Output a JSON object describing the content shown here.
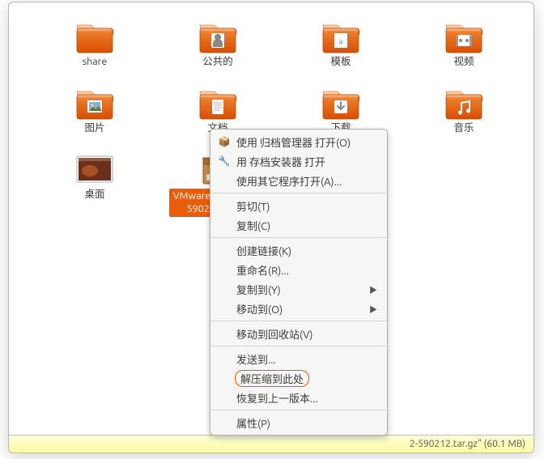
{
  "icons": [
    {
      "label": "share",
      "type": "folder-plain"
    },
    {
      "label": "公共的",
      "type": "folder-person"
    },
    {
      "label": "模板",
      "type": "folder-template"
    },
    {
      "label": "视频",
      "type": "folder-video"
    },
    {
      "label": "图片",
      "type": "folder-pictures"
    },
    {
      "label": "文档",
      "type": "folder-docs"
    },
    {
      "label": "下载",
      "type": "folder-download"
    },
    {
      "label": "音乐",
      "type": "folder-music"
    },
    {
      "label": "桌面",
      "type": "desktop-thumb"
    },
    {
      "label": "VMwareTools-8.8 2-590212.tar.gz",
      "type": "archive",
      "selected": true
    }
  ],
  "menu": [
    {
      "label": "使用 归档管理器 打开(O)",
      "icon": "📦"
    },
    {
      "label": "用 存档安装器 打开",
      "icon": "🔧"
    },
    {
      "label": "使用其它程序打开(A)..."
    },
    {
      "sep": true
    },
    {
      "label": "剪切(T)"
    },
    {
      "label": "复制(C)"
    },
    {
      "sep": true
    },
    {
      "label": "创建链接(K)"
    },
    {
      "label": "重命名(R)..."
    },
    {
      "label": "复制到(Y)",
      "submenu": true
    },
    {
      "label": "移动到(O)",
      "submenu": true
    },
    {
      "sep": true
    },
    {
      "label": "移动到回收站(V)"
    },
    {
      "sep": true
    },
    {
      "label": "发送到..."
    },
    {
      "label": "解压缩到此处",
      "highlight": true
    },
    {
      "label": "恢复到上一版本..."
    },
    {
      "sep": true
    },
    {
      "label": "属性(P)"
    }
  ],
  "status": {
    "text": "2-590212.tar.gz\" (60.1 MB)"
  },
  "colors": {
    "accent": "#e85d0a",
    "folder_base": "#e85d0a",
    "folder_light": "#ffb88a"
  }
}
